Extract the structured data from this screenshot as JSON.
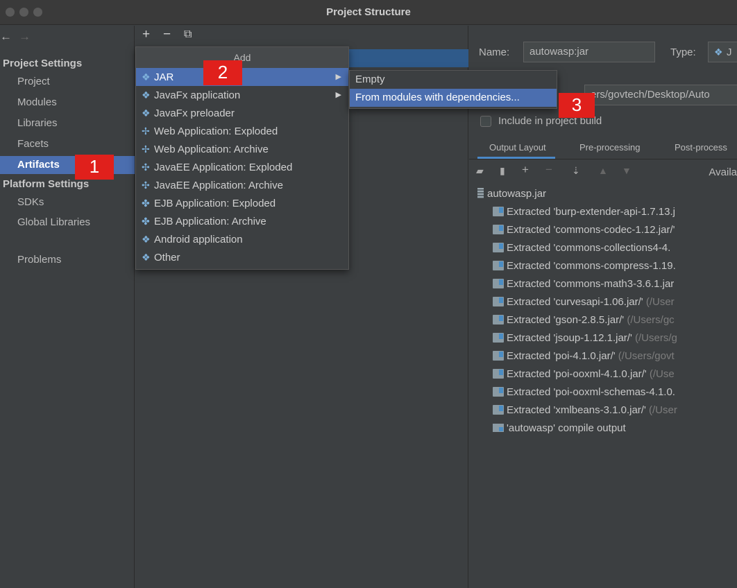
{
  "window": {
    "title": "Project Structure"
  },
  "nav": {
    "back": "←",
    "forward": "→"
  },
  "sidebar": {
    "project_settings_header": "Project Settings",
    "items": [
      "Project",
      "Modules",
      "Libraries",
      "Facets",
      "Artifacts"
    ],
    "platform_settings_header": "Platform Settings",
    "platform_items": [
      "SDKs",
      "Global Libraries"
    ],
    "problems": "Problems"
  },
  "toolbar": {
    "add": "+",
    "remove": "−",
    "copy": "⧉"
  },
  "add_menu": {
    "title": "Add",
    "items": [
      {
        "label": "JAR",
        "icon": "artifact-diamond-icon",
        "has_submenu": true
      },
      {
        "label": "JavaFx application",
        "icon": "artifact-diamond-icon",
        "has_submenu": true
      },
      {
        "label": "JavaFx preloader",
        "icon": "artifact-diamond-icon"
      },
      {
        "label": "Web Application: Exploded",
        "icon": "web-artifact-icon"
      },
      {
        "label": "Web Application: Archive",
        "icon": "web-artifact-icon"
      },
      {
        "label": "JavaEE Application: Exploded",
        "icon": "javaee-artifact-icon"
      },
      {
        "label": "JavaEE Application: Archive",
        "icon": "javaee-artifact-icon"
      },
      {
        "label": "EJB Application: Exploded",
        "icon": "ejb-artifact-icon"
      },
      {
        "label": "EJB Application: Archive",
        "icon": "ejb-artifact-icon"
      },
      {
        "label": "Android application",
        "icon": "artifact-diamond-icon"
      },
      {
        "label": "Other",
        "icon": "artifact-diamond-icon"
      }
    ]
  },
  "jar_submenu": {
    "items": [
      "Empty",
      "From modules with dependencies..."
    ]
  },
  "annotations": {
    "one": "1",
    "two": "2",
    "three": "3"
  },
  "details": {
    "name_label": "Name:",
    "name_value": "autowasp:jar",
    "type_label": "Type:",
    "type_value": "J",
    "output_dir": "ers/govtech/Desktop/Auto",
    "include_label": "Include in project build",
    "tabs": [
      "Output Layout",
      "Pre-processing",
      "Post-process"
    ],
    "available_label": "Availa"
  },
  "tree": {
    "root": "autowasp.jar",
    "entries": [
      {
        "name": "Extracted 'burp-extender-api-1.7.13.j",
        "path": ""
      },
      {
        "name": "Extracted 'commons-codec-1.12.jar/'",
        "path": ""
      },
      {
        "name": "Extracted 'commons-collections4-4.",
        "path": ""
      },
      {
        "name": "Extracted 'commons-compress-1.19.",
        "path": ""
      },
      {
        "name": "Extracted 'commons-math3-3.6.1.jar",
        "path": ""
      },
      {
        "name": "Extracted 'curvesapi-1.06.jar/'",
        "path": " (/User"
      },
      {
        "name": "Extracted 'gson-2.8.5.jar/'",
        "path": " (/Users/gc"
      },
      {
        "name": "Extracted 'jsoup-1.12.1.jar/'",
        "path": " (/Users/g"
      },
      {
        "name": "Extracted 'poi-4.1.0.jar/'",
        "path": " (/Users/govt"
      },
      {
        "name": "Extracted 'poi-ooxml-4.1.0.jar/'",
        "path": " (/Use"
      },
      {
        "name": "Extracted 'poi-ooxml-schemas-4.1.0.",
        "path": ""
      },
      {
        "name": "Extracted 'xmlbeans-3.1.0.jar/'",
        "path": " (/User"
      }
    ],
    "compile_output": "'autowasp' compile output"
  },
  "colors": {
    "selection": "#4b6eaf",
    "badge": "#e0201c",
    "panel": "#3c3f41"
  }
}
